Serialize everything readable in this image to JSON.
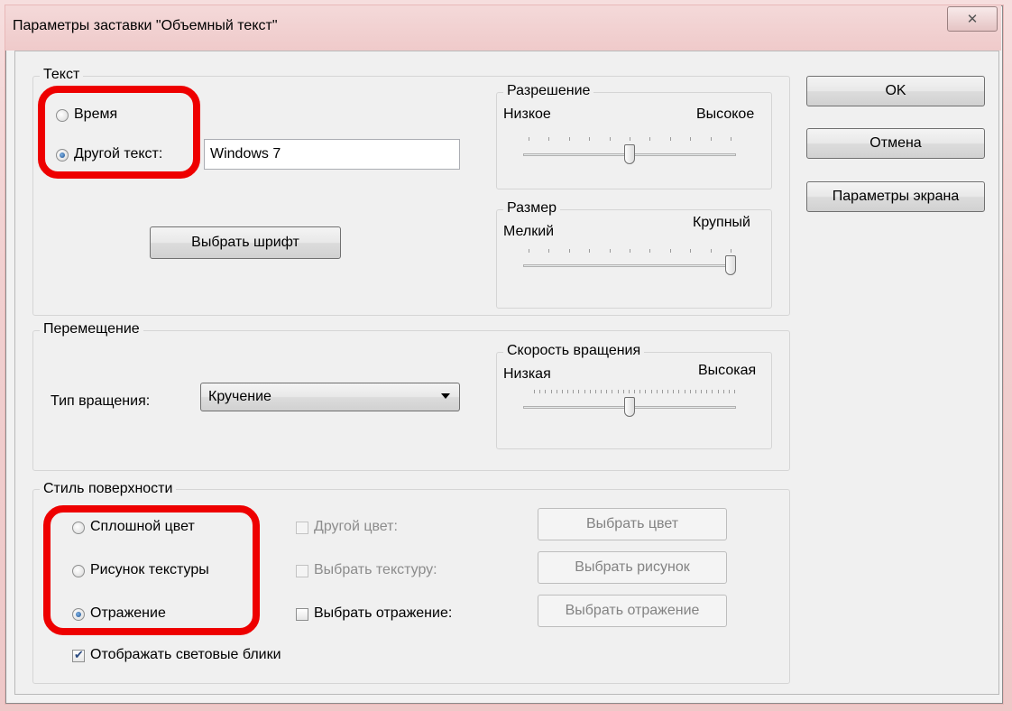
{
  "window": {
    "title": "Параметры заставки \"Объемный текст\"",
    "close_label": "✕"
  },
  "text_group": {
    "label": "Текст",
    "radio_time": "Время",
    "radio_other": "Другой текст:",
    "other_value": "Windows 7",
    "font_button": "Выбрать шрифт",
    "resolution": {
      "label": "Разрешение",
      "low": "Низкое",
      "high": "Высокое",
      "level": 0.5
    },
    "size": {
      "label": "Размер",
      "small": "Мелкий",
      "large": "Крупный",
      "level": 1.0
    }
  },
  "motion_group": {
    "label": "Перемещение",
    "rotation_type_label": "Тип вращения:",
    "rotation_type_value": "Кручение",
    "speed": {
      "label": "Скорость вращения",
      "low": "Низкая",
      "high": "Высокая",
      "level": 0.5
    }
  },
  "surface_group": {
    "label": "Стиль поверхности",
    "radio_solid": "Сплошной цвет",
    "radio_texture": "Рисунок текстуры",
    "radio_reflection": "Отражение",
    "chk_color": "Другой цвет:",
    "chk_texture": "Выбрать текстуру:",
    "chk_reflection": "Выбрать отражение:",
    "btn_color": "Выбрать цвет",
    "btn_picture": "Выбрать рисунок",
    "btn_reflection": "Выбрать отражение",
    "chk_highlights": "Отображать световые блики"
  },
  "buttons": {
    "ok": "OK",
    "cancel": "Отмена",
    "screen_settings": "Параметры экрана"
  },
  "selected_text_mode": "other",
  "selected_surface": "reflection",
  "highlight_color": "#ee0000"
}
